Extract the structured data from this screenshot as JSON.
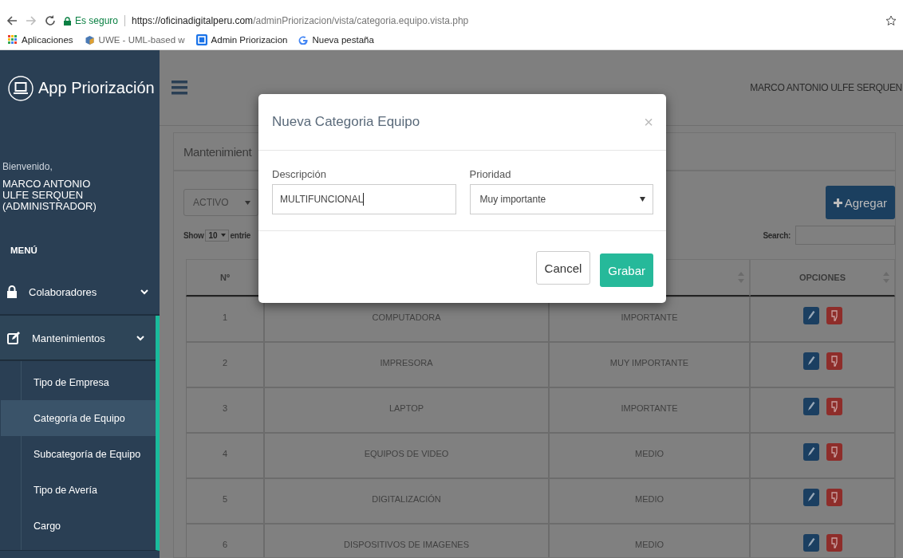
{
  "browser": {
    "forward_disabled": true,
    "secure_label": "Es seguro",
    "url_host": "https://oficinadigitalperu.com",
    "url_path": "/adminPriorizacion/vista/categoria.equipo.vista.php"
  },
  "bookmarks": [
    {
      "kind": "apps",
      "label": "Aplicaciones"
    },
    {
      "kind": "uwe",
      "label": "UWE - UML-based w"
    },
    {
      "kind": "admin",
      "label": "Admin Priorizacion"
    },
    {
      "kind": "google",
      "label": "Nueva pestaña"
    }
  ],
  "sidebar": {
    "app_title": "App Priorización",
    "welcome": "Bienvenido,",
    "user_lines": [
      "MARCO ANTONIO",
      "ULFE SERQUEN",
      "(ADMINISTRADOR)"
    ],
    "menu_heading": "MENÚ",
    "items": [
      {
        "kind": "lock",
        "label": "Colaboradores",
        "active": false
      },
      {
        "kind": "edit",
        "label": "Mantenimientos",
        "active": true,
        "children": [
          {
            "label": "Tipo de Empresa",
            "selected": false
          },
          {
            "label": "Categoría de Equipo",
            "selected": true
          },
          {
            "label": "Subcategoría de Equipo",
            "selected": false
          },
          {
            "label": "Tipo de Avería",
            "selected": false
          },
          {
            "label": "Cargo",
            "selected": false
          }
        ]
      }
    ]
  },
  "topbar": {
    "user_name": "MARCO ANTONIO ULFE SERQUEN"
  },
  "panel": {
    "title": "Mantenimient",
    "status_filter": "ACTIVO",
    "add_button": "Agregar",
    "show_label": "Show",
    "page_size": "10",
    "entries_label": "entrie",
    "search_label": "Search:",
    "table": {
      "columns": [
        "Nº",
        "OPCIONES"
      ],
      "rows": [
        {
          "number": "1",
          "description": "COMPUTADORA",
          "priority": "IMPORTANTE"
        },
        {
          "number": "2",
          "description": "IMPRESORA",
          "priority": "MUY IMPORTANTE"
        },
        {
          "number": "3",
          "description": "LAPTOP",
          "priority": "IMPORTANTE"
        },
        {
          "number": "4",
          "description": "EQUIPOS DE VIDEO",
          "priority": "MEDIO"
        },
        {
          "number": "5",
          "description": "DIGITALIZACIÓN",
          "priority": "MEDIO"
        },
        {
          "number": "6",
          "description": "DISPOSITIVOS DE IMAGENES",
          "priority": "MEDIO"
        }
      ]
    }
  },
  "modal": {
    "title": "Nueva Categoria Equipo",
    "close": "×",
    "description_label": "Descripción",
    "description_value": "MULTIFUNCIONAL",
    "priority_label": "Prioridad",
    "priority_value": "Muy importante",
    "cancel_button": "Cancel",
    "save_button": "Grabar"
  }
}
